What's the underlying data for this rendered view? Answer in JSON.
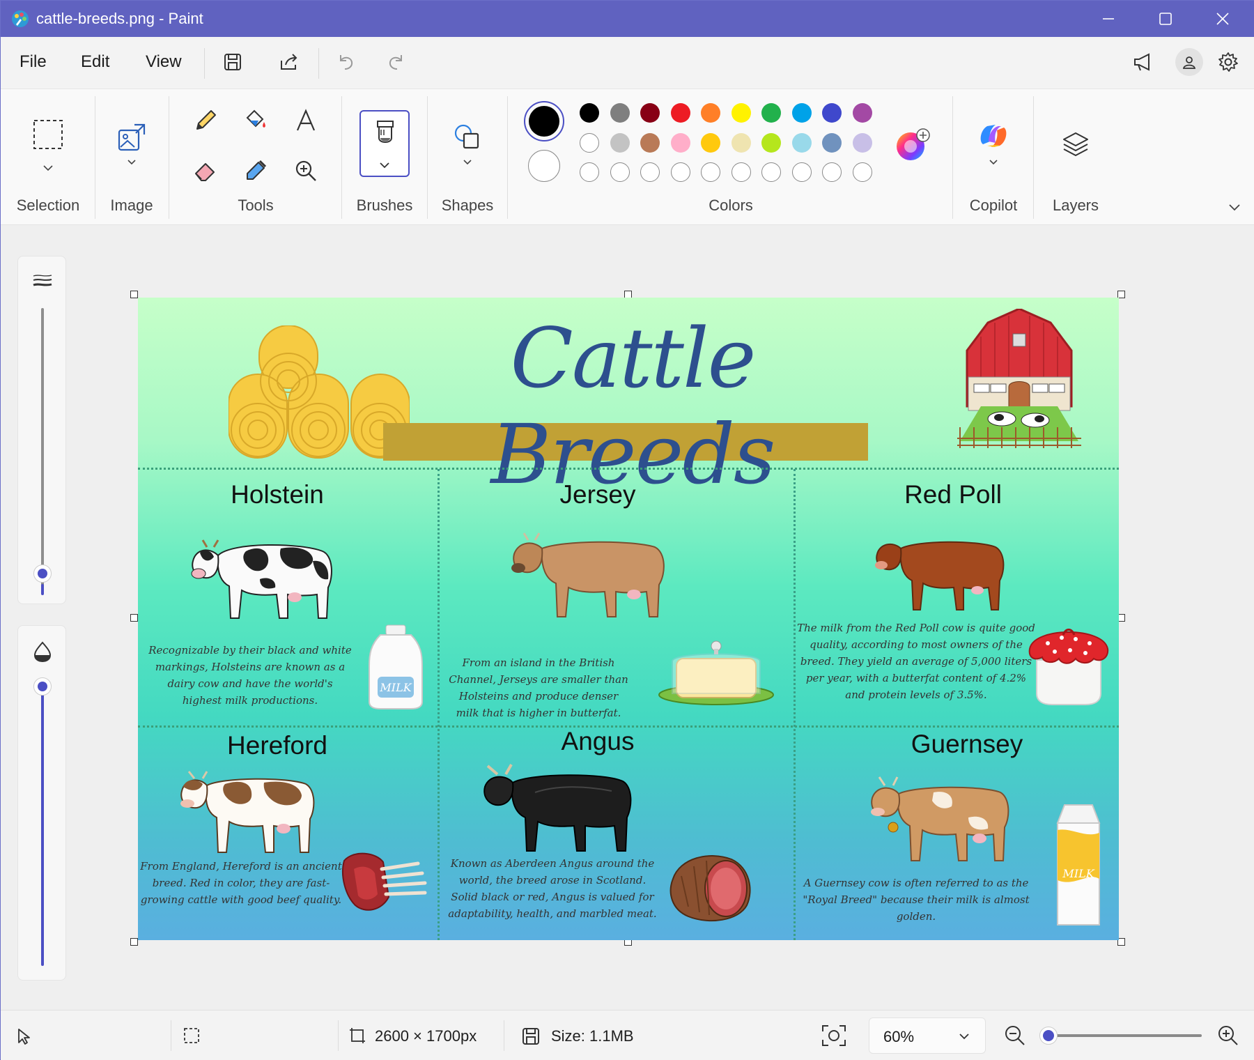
{
  "window": {
    "title": "cattle-breeds.png - Paint"
  },
  "menu": {
    "file": "File",
    "edit": "Edit",
    "view": "View"
  },
  "ribbon": {
    "groups": {
      "selection": "Selection",
      "image": "Image",
      "tools": "Tools",
      "brushes": "Brushes",
      "shapes": "Shapes",
      "colors": "Colors",
      "copilot": "Copilot",
      "layers": "Layers"
    },
    "primary_color": "#000000",
    "secondary_color": "#ffffff",
    "palette_row1": [
      "#000000",
      "#7f7f7f",
      "#880015",
      "#ed1c24",
      "#ff7f27",
      "#fff200",
      "#22b14c",
      "#00a2e8",
      "#3f48cc",
      "#a349a4"
    ],
    "palette_row2": [
      "#ffffff",
      "#c3c3c3",
      "#b97a57",
      "#ffaec9",
      "#ffc90e",
      "#efe4b0",
      "#b5e61d",
      "#99d9ea",
      "#7092be",
      "#c8bfe7"
    ]
  },
  "canvas": {
    "header_title": "Cattle Breeds",
    "breeds": [
      {
        "name": "Holstein",
        "description": "Recognizable by their black and white markings, Holsteins are known as a dairy cow and have the world's highest milk productions.",
        "product": "Milk"
      },
      {
        "name": "Jersey",
        "description": "From an island in the British Channel, Jerseys are smaller than Holsteins and produce  denser milk that is higher in butterfat.",
        "product": "Butter"
      },
      {
        "name": "Red Poll",
        "description": "The milk from the Red Poll cow is quite good quality, according to most owners of the breed. They yield an average of 5,000 liters per year, with a butterfat content of 4.2% and protein levels of 3.5%.",
        "product": "Yogurt jar"
      },
      {
        "name": "Hereford",
        "description": "From England, Hereford is an ancient breed. Red in color, they are fast-growing cattle with good beef quality.",
        "product": "Rack of beef"
      },
      {
        "name": "Angus",
        "description": "Known as Aberdeen Angus around the world, the breed arose in Scotland. Solid black or red, Angus is valued for adaptability, health, and marbled meat.",
        "product": "Roast beef"
      },
      {
        "name": "Guernsey",
        "description": "A Guernsey cow is often referred to as the \"Royal Breed\" because their milk is almost golden.",
        "product": "Milk carton"
      }
    ],
    "milk_label": "MILK",
    "carton_label": "MILK"
  },
  "status": {
    "dimensions": "2600 × 1700px",
    "size": "Size: 1.1MB",
    "zoom": "60%",
    "zoom_fraction": 0.05
  }
}
